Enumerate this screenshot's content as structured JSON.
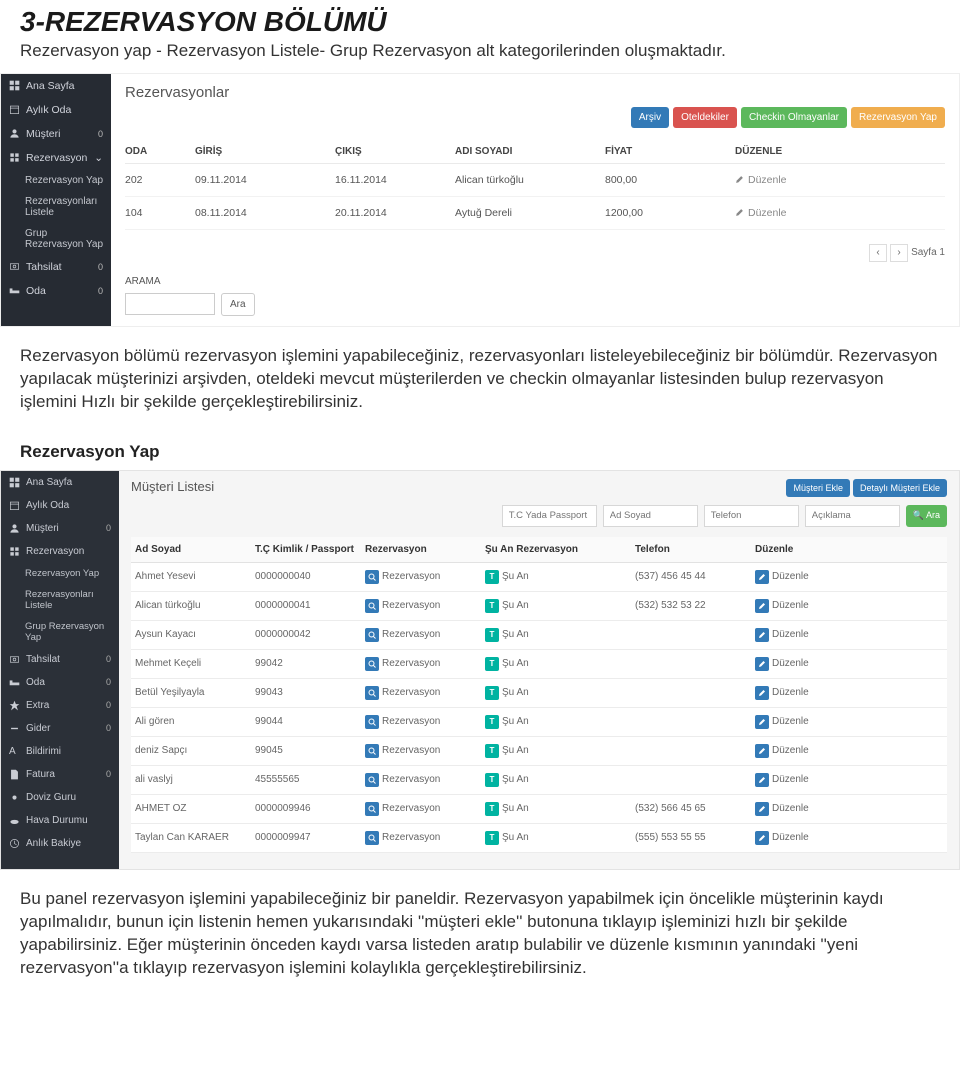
{
  "doc": {
    "heading": "3-REZERVASYON BÖLÜMÜ",
    "description": "Rezervasyon yap - Rezervasyon Listele- Grup Rezervasyon alt kategorilerinden oluşmaktadır.",
    "para2": "Rezervasyon bölümü rezervasyon işlemini yapabileceğiniz, rezervasyonları listeleyebileceğiniz bir bölümdür. Rezervasyon yapılacak müşterinizi arşivden, oteldeki mevcut müşterilerden ve checkin olmayanlar listesinden bulup rezervasyon işlemini Hızlı bir şekilde gerçekleştirebilirsiniz.",
    "sub1": "Rezervasyon Yap",
    "para3": "Bu panel rezervasyon işlemini yapabileceğiniz bir paneldir. Rezervasyon yapabilmek için öncelikle müşterinin kaydı yapılmalıdır, bunun için listenin hemen yukarısındaki ''müşteri ekle'' butonuna tıklayıp işleminizi hızlı bir şekilde yapabilirsiniz. Eğer müşterinin önceden kaydı varsa listeden aratıp bulabilir ve düzenle kısmının yanındaki ''yeni rezervasyon''a tıklayıp rezervasyon işlemini kolaylıkla gerçekleştirebilirsiniz."
  },
  "sidebar": {
    "items": [
      {
        "icon": "dashboard",
        "label": "Ana Sayfa"
      },
      {
        "icon": "calendar",
        "label": "Aylık Oda"
      },
      {
        "icon": "users",
        "label": "Müşteri",
        "badge": "0"
      },
      {
        "icon": "grid",
        "label": "Rezervasyon",
        "open": true
      },
      {
        "icon": "money",
        "label": "Tahsilat",
        "badge": "0"
      },
      {
        "icon": "bed",
        "label": "Oda",
        "badge": "0"
      }
    ],
    "rez_sub": [
      "Rezervasyon Yap",
      "Rezervasyonları Listele",
      "Grup Rezervasyon Yap"
    ]
  },
  "shot1": {
    "title": "Rezervasyonlar",
    "buttons": {
      "archive": "Arşiv",
      "guests": "Oteldekiler",
      "noncheckin": "Checkin Olmayanlar",
      "addrez": "Rezervasyon Yap"
    },
    "cols": {
      "oda": "ODA",
      "giris": "GİRİŞ",
      "cikis": "ÇIKIŞ",
      "ad": "ADI SOYADI",
      "fiyat": "FİYAT",
      "duzenle": "DÜZENLE"
    },
    "rows": [
      {
        "oda": "202",
        "giris": "09.11.2014",
        "cikis": "16.11.2014",
        "ad": "Alican türkoğlu",
        "fiyat": "800,00",
        "edit": "Düzenle"
      },
      {
        "oda": "104",
        "giris": "08.11.2014",
        "cikis": "20.11.2014",
        "ad": "Aytuğ Dereli",
        "fiyat": "1200,00",
        "edit": "Düzenle"
      }
    ],
    "pagelabel": "Sayfa 1",
    "arama": "ARAMA",
    "arabtn": "Ara"
  },
  "sidebar2": {
    "items": [
      {
        "icon": "dashboard",
        "label": "Ana Sayfa"
      },
      {
        "icon": "calendar",
        "label": "Aylık Oda"
      },
      {
        "icon": "users",
        "label": "Müşteri",
        "badge": "0"
      },
      {
        "icon": "grid",
        "label": "Rezervasyon",
        "open": true
      },
      {
        "icon": "money",
        "label": "Tahsilat",
        "badge": "0"
      },
      {
        "icon": "bed",
        "label": "Oda",
        "badge": "0"
      },
      {
        "icon": "star",
        "label": "Extra",
        "badge": "0"
      },
      {
        "icon": "minus",
        "label": "Gider",
        "badge": "0"
      },
      {
        "icon": "font",
        "label": "Bildirimi"
      },
      {
        "icon": "file",
        "label": "Fatura",
        "badge": "0"
      },
      {
        "icon": "sun",
        "label": "Doviz Guru"
      },
      {
        "icon": "cloud",
        "label": "Hava Durumu"
      },
      {
        "icon": "clock",
        "label": "Anlık Bakiye"
      }
    ]
  },
  "shot2": {
    "title": "Müşteri Listesi",
    "buttons": {
      "add": "Müşteri Ekle",
      "adddetail": "Detaylı Müşteri Ekle"
    },
    "filters": {
      "tc": "T.C Yada Passport",
      "ad": "Ad Soyad",
      "tel": "Telefon",
      "ack": "Açıklama",
      "ara": "Ara"
    },
    "cols": {
      "ad": "Ad Soyad",
      "tc": "T.Ç Kimlik / Passport",
      "rez": "Rezervasyon",
      "suan": "Şu An Rezervasyon",
      "tel": "Telefon",
      "duzenle": "Düzenle"
    },
    "rows": [
      {
        "ad": "Ahmet Yesevi",
        "tc": "0000000040",
        "tel": "(537) 456 45 44"
      },
      {
        "ad": "Alican türkoğlu",
        "tc": "0000000041",
        "tel": "(532) 532 53 22"
      },
      {
        "ad": "Aysun Kayacı",
        "tc": "0000000042",
        "tel": ""
      },
      {
        "ad": "Mehmet Keçeli",
        "tc": "99042",
        "tel": ""
      },
      {
        "ad": "Betül Yeşilyayla",
        "tc": "99043",
        "tel": ""
      },
      {
        "ad": "Ali gören",
        "tc": "99044",
        "tel": ""
      },
      {
        "ad": "deniz Sapçı",
        "tc": "99045",
        "tel": ""
      },
      {
        "ad": "ali vaslyj",
        "tc": "45555565",
        "tel": ""
      },
      {
        "ad": "AHMET OZ",
        "tc": "0000009946",
        "tel": "(532) 566 45 65"
      },
      {
        "ad": "Taylan Can KARAER",
        "tc": "0000009947",
        "tel": "(555) 553 55 55"
      }
    ],
    "cellbtns": {
      "rez": "Rezervasyon",
      "suan": "Şu An",
      "edit": "Düzenle"
    }
  }
}
